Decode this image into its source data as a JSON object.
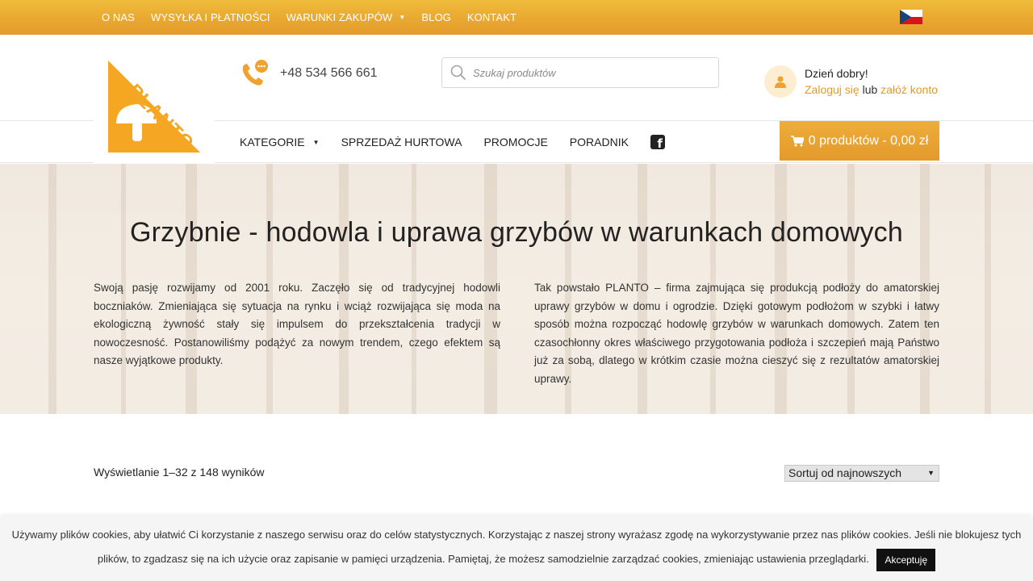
{
  "topbar": {
    "items": [
      {
        "label": "O NAS"
      },
      {
        "label": "WYSYŁKA I PŁATNOŚCI"
      },
      {
        "label": "WARUNKI ZAKUPÓW"
      },
      {
        "label": "BLOG"
      },
      {
        "label": "KONTAKT"
      }
    ],
    "flag": "czech-flag-icon",
    "gradient": [
      "#f0bb3a",
      "#e39a2a"
    ]
  },
  "header": {
    "logo_text": "PLANTO",
    "phone": "+48 534 566 661",
    "search_placeholder": "Szukaj produktów",
    "account": {
      "greeting": "Dzień dobry!",
      "login": "Zaloguj się",
      "or": "lub",
      "register": "załóż konto"
    }
  },
  "mainnav": {
    "items": [
      {
        "label": "KATEGORIE"
      },
      {
        "label": "SPRZEDAŻ HURTOWA"
      },
      {
        "label": "PROMOCJE"
      },
      {
        "label": "PORADNIK"
      }
    ],
    "cart": "0 produktów - 0,00 zł"
  },
  "hero": {
    "title": "Grzybnie - hodowla i uprawa grzybów w warunkach domowych",
    "col1": "Swoją pasję rozwijamy od 2001 roku. Zaczęło się od tradycyjnej hodowli boczniaków. Zmieniająca się sytuacja na rynku i wciąż rozwijająca się moda na ekologiczną żywność stały się impulsem do przekształcenia tradycji w nowoczesność. Postanowiliśmy podążyć za nowym trendem, czego efektem są nasze wyjątkowe produkty.",
    "col2": "Tak powstało PLANTO – firma zajmująca się produkcją podłoży do amatorskiej uprawy grzybów w domu i ogrodzie. Dzięki gotowym podłożom w szybki i łatwy sposób można rozpocząć hodowlę grzybów w warunkach domowych. Zatem ten czasochłonny okres właściwego przygotowania podłoża i szczepień mają Państwo już za sobą, dlatego w krótkim czasie można cieszyć się z rezultatów amatorskiej uprawy."
  },
  "shop": {
    "results": "Wyświetlanie 1–32 z 148 wyników",
    "sort": "Sortuj od najnowszych"
  },
  "cookie": {
    "text": "Używamy plików cookies, aby ułatwić Ci korzystanie z naszego serwisu oraz do celów statystycznych. Korzystając z naszej strony wyrażasz zgodę na wykorzystywanie przez nas plików cookies. Jeśli nie blokujesz tych plików, to zgadzasz się na ich użycie oraz zapisanie w pamięci urządzenia. Pamiętaj, że możesz samodzielnie zarządzać cookies, zmieniając ustawienia przeglądarki.",
    "accept": "Akceptuję"
  },
  "colors": {
    "accent": "#e39a2a",
    "accent_light": "#f0bb3a",
    "logo": "#f5a623"
  }
}
